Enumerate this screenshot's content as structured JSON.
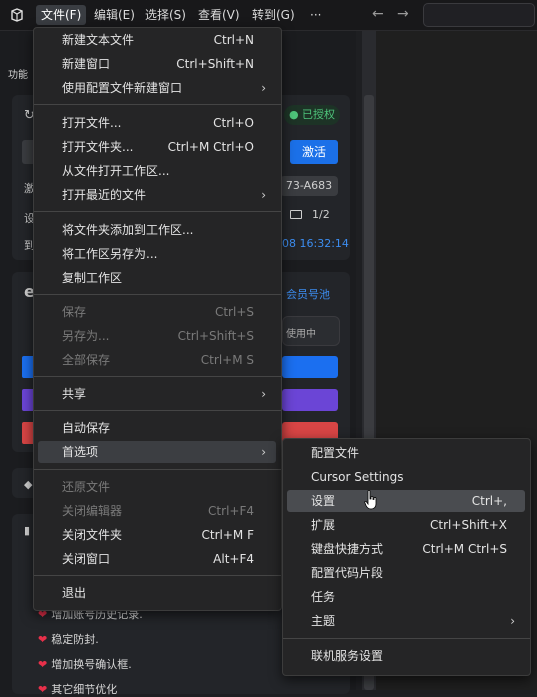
{
  "menubar": {
    "items": [
      "文件(F)",
      "编辑(E)",
      "选择(S)",
      "查看(V)",
      "转到(G)",
      "···"
    ],
    "back": "←",
    "forward": "→"
  },
  "background": {
    "title": "功能",
    "auth_badge": "● 已授权",
    "activate_button": "激活",
    "code_chip": "73-A683",
    "row_labels": [
      "激",
      "设",
      "到"
    ],
    "page_counter": "1/2",
    "timestamp": "08 16:32:14",
    "logo_letter": "e",
    "member_link": "会员号池",
    "in_use": "使用中",
    "changelog": [
      "增加账号历史记录.",
      "稳定防封.",
      "增加换号确认框.",
      "其它细节优化"
    ],
    "colors": {
      "blue": "#1b6ff0",
      "purple": "#6b45d6",
      "red": "#d84545"
    }
  },
  "file_menu": [
    {
      "label": "新建文本文件",
      "shortcut": "Ctrl+N"
    },
    {
      "label": "新建窗口",
      "shortcut": "Ctrl+Shift+N"
    },
    {
      "label": "使用配置文件新建窗口",
      "shortcut": "",
      "submenu": true
    },
    {
      "label": "打开文件...",
      "shortcut": "Ctrl+O"
    },
    {
      "label": "打开文件夹...",
      "shortcut": "Ctrl+M Ctrl+O"
    },
    {
      "label": "从文件打开工作区...",
      "shortcut": ""
    },
    {
      "label": "打开最近的文件",
      "shortcut": "",
      "submenu": true
    },
    {
      "label": "将文件夹添加到工作区...",
      "shortcut": ""
    },
    {
      "label": "将工作区另存为...",
      "shortcut": ""
    },
    {
      "label": "复制工作区",
      "shortcut": ""
    },
    {
      "label": "保存",
      "shortcut": "Ctrl+S",
      "disabled": true
    },
    {
      "label": "另存为...",
      "shortcut": "Ctrl+Shift+S",
      "disabled": true
    },
    {
      "label": "全部保存",
      "shortcut": "Ctrl+M S",
      "disabled": true
    },
    {
      "label": "共享",
      "shortcut": "",
      "submenu": true
    },
    {
      "label": "自动保存",
      "shortcut": ""
    },
    {
      "label": "首选项",
      "shortcut": "",
      "submenu": true,
      "highlighted": true
    },
    {
      "label": "还原文件",
      "shortcut": "",
      "disabled": true
    },
    {
      "label": "关闭编辑器",
      "shortcut": "Ctrl+F4",
      "disabled": true
    },
    {
      "label": "关闭文件夹",
      "shortcut": "Ctrl+M F"
    },
    {
      "label": "关闭窗口",
      "shortcut": "Alt+F4"
    },
    {
      "label": "退出",
      "shortcut": ""
    }
  ],
  "preferences_menu": [
    {
      "label": "配置文件",
      "shortcut": ""
    },
    {
      "label": "Cursor Settings",
      "shortcut": ""
    },
    {
      "label": "设置",
      "shortcut": "Ctrl+,",
      "highlighted": true
    },
    {
      "label": "扩展",
      "shortcut": "Ctrl+Shift+X"
    },
    {
      "label": "键盘快捷方式",
      "shortcut": "Ctrl+M Ctrl+S"
    },
    {
      "label": "配置代码片段",
      "shortcut": ""
    },
    {
      "label": "任务",
      "shortcut": ""
    },
    {
      "label": "主题",
      "shortcut": "",
      "submenu": true
    },
    {
      "label": "联机服务设置",
      "shortcut": ""
    }
  ]
}
